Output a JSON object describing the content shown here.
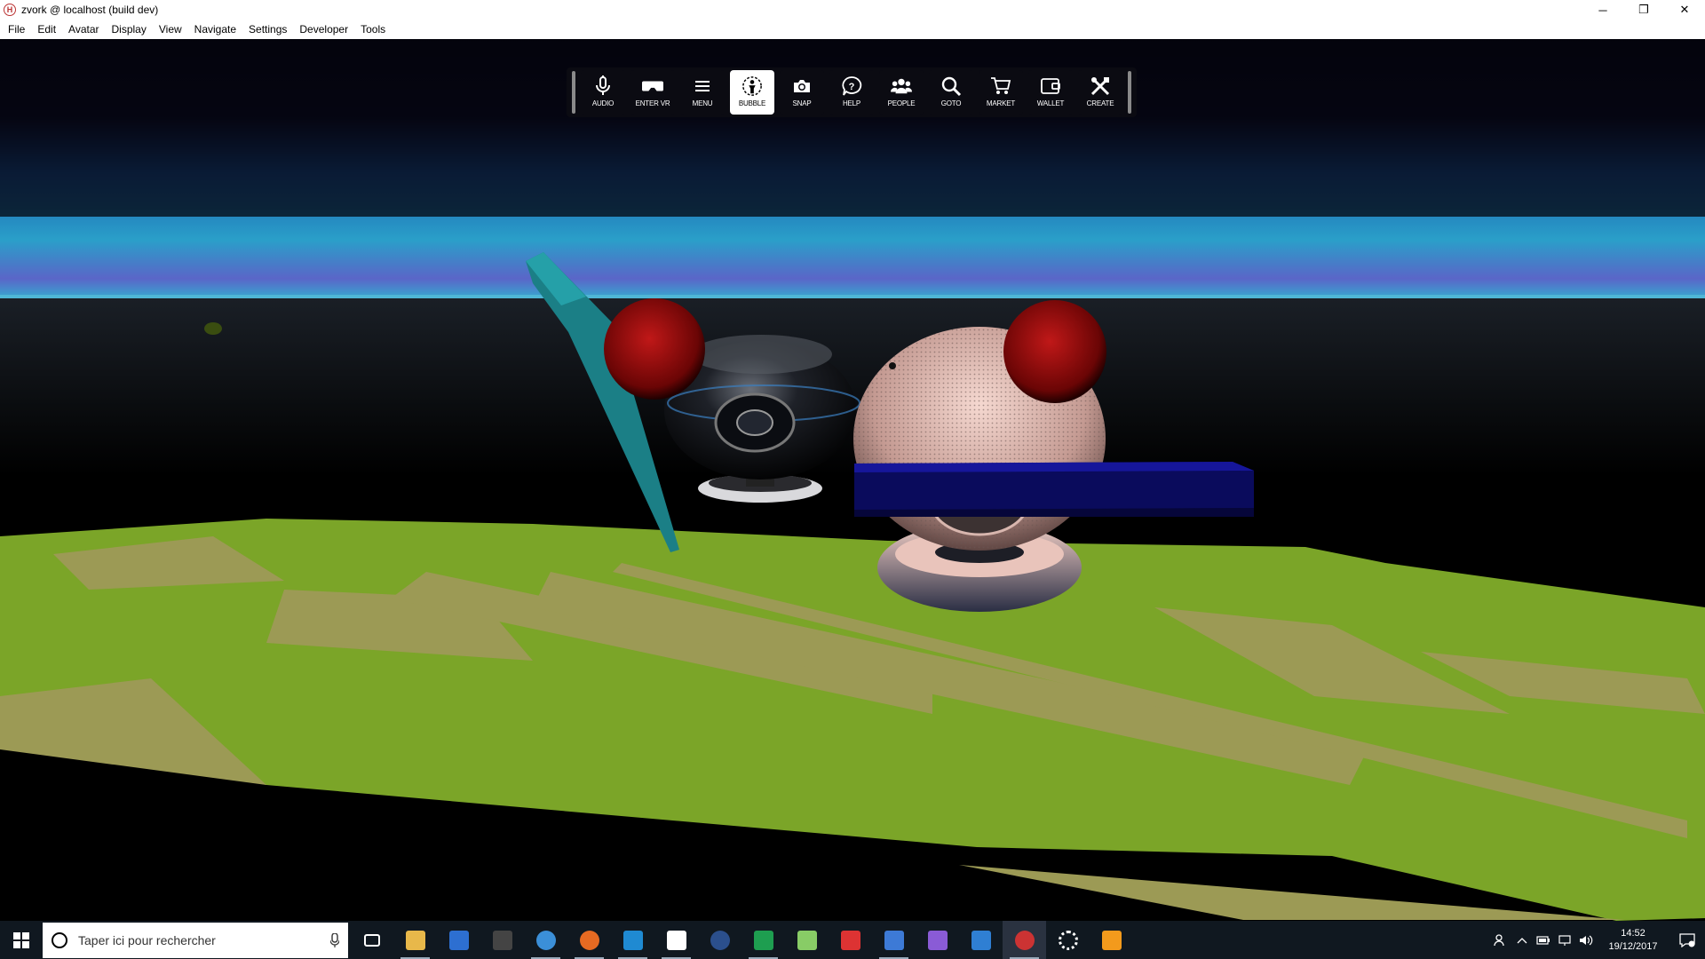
{
  "window": {
    "title": "zvork @ localhost (build dev)",
    "controls": {
      "minimize": "─",
      "restore": "❐",
      "close": "✕"
    }
  },
  "menubar": {
    "items": [
      {
        "label": "File"
      },
      {
        "label": "Edit"
      },
      {
        "label": "Avatar"
      },
      {
        "label": "Display"
      },
      {
        "label": "View"
      },
      {
        "label": "Navigate"
      },
      {
        "label": "Settings"
      },
      {
        "label": "Developer"
      },
      {
        "label": "Tools"
      }
    ]
  },
  "toolbar": {
    "buttons": [
      {
        "label": "AUDIO",
        "icon": "microphone-icon",
        "active": false
      },
      {
        "label": "ENTER VR",
        "icon": "vr-headset-icon",
        "active": false
      },
      {
        "label": "MENU",
        "icon": "hamburger-menu-icon",
        "active": false
      },
      {
        "label": "BUBBLE",
        "icon": "bubble-icon",
        "active": true
      },
      {
        "label": "SNAP",
        "icon": "camera-icon",
        "active": false
      },
      {
        "label": "HELP",
        "icon": "help-icon",
        "active": false
      },
      {
        "label": "PEOPLE",
        "icon": "people-icon",
        "active": false
      },
      {
        "label": "GOTO",
        "icon": "search-icon",
        "active": false
      },
      {
        "label": "MARKET",
        "icon": "cart-icon",
        "active": false
      },
      {
        "label": "WALLET",
        "icon": "wallet-icon",
        "active": false
      },
      {
        "label": "CREATE",
        "icon": "create-tools-icon",
        "active": false
      }
    ]
  },
  "taskbar": {
    "search_placeholder": "Taper ici pour rechercher",
    "apps": [
      {
        "name": "task-view-icon",
        "color": "#101820",
        "running": false
      },
      {
        "name": "file-explorer-icon",
        "color": "#e8b84a",
        "running": true
      },
      {
        "name": "store-icon",
        "color": "#2d6fd1",
        "running": false
      },
      {
        "name": "calculator-icon",
        "color": "#444",
        "running": false
      },
      {
        "name": "edge-icon",
        "color": "#3b8fd8",
        "running": true
      },
      {
        "name": "firefox-icon",
        "color": "#e66a22",
        "running": true
      },
      {
        "name": "vscode-icon",
        "color": "#1f8ad2",
        "running": true
      },
      {
        "name": "slack-icon",
        "color": "#fff",
        "running": true
      },
      {
        "name": "vpn-icon",
        "color": "#2b4f8c",
        "running": false
      },
      {
        "name": "sheets-icon",
        "color": "#1e9e50",
        "running": true
      },
      {
        "name": "git-icon",
        "color": "#8c6",
        "running": false
      },
      {
        "name": "paint-icon",
        "color": "#d33",
        "running": false
      },
      {
        "name": "document-icon",
        "color": "#3d7ad6",
        "running": true
      },
      {
        "name": "visual-studio-icon",
        "color": "#8a5bd6",
        "running": false
      },
      {
        "name": "window-app-icon",
        "color": "#2f7fd3",
        "running": false
      },
      {
        "name": "highfidelity-icon",
        "color": "#c33",
        "running": true
      },
      {
        "name": "settings-gear-icon",
        "color": "#fff",
        "running": false
      },
      {
        "name": "fox-app-icon",
        "color": "#f39a1c",
        "running": false
      }
    ],
    "clock_time": "14:52",
    "clock_date": "19/12/2017"
  }
}
